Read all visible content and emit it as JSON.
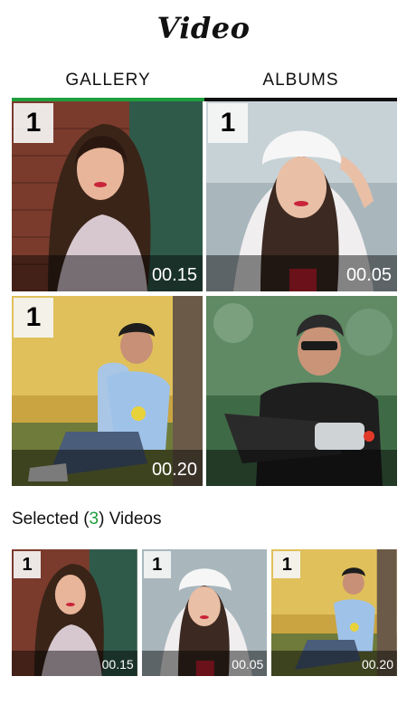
{
  "header": {
    "title": "Video"
  },
  "tabs": [
    {
      "label": "GALLERY",
      "active": true
    },
    {
      "label": "ALBUMS",
      "active": false
    }
  ],
  "gallery": [
    {
      "badge": "1",
      "duration": "00.15",
      "subject": "woman-with-long-hair-brick-wall"
    },
    {
      "badge": "1",
      "duration": "00.05",
      "subject": "woman-with-white-beanie"
    },
    {
      "badge": "1",
      "duration": "00.20",
      "subject": "man-sitting-by-tree"
    },
    {
      "badge": "",
      "duration": "",
      "subject": "man-on-scooter"
    }
  ],
  "selected": {
    "prefix": "Selected (",
    "count": "3",
    "suffix": ") Videos",
    "items": [
      {
        "badge": "1",
        "duration": "00.15"
      },
      {
        "badge": "1",
        "duration": "00.05"
      },
      {
        "badge": "1",
        "duration": "00.20"
      }
    ]
  },
  "colors": {
    "accent": "#1e9e3c",
    "tab_underline": "#111111"
  }
}
